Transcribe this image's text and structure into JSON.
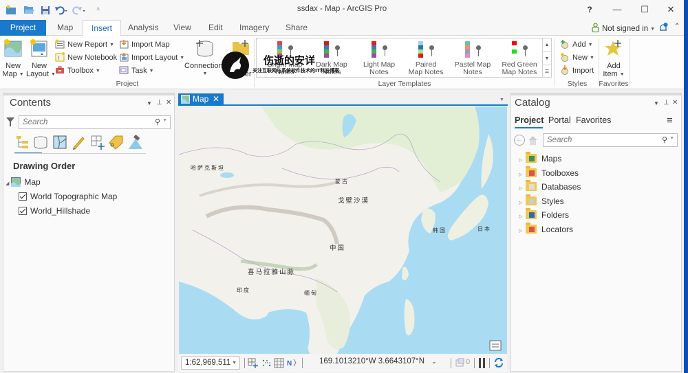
{
  "window": {
    "title": "ssdax - Map - ArcGIS Pro",
    "help": "?",
    "minimize": "—",
    "maximize": "☐",
    "close": "✕"
  },
  "quick_access": [
    "new-project-icon",
    "open-project-icon",
    "save-project-icon",
    "undo-icon",
    "redo-icon",
    "customize-qat-icon"
  ],
  "account": {
    "label": "Not signed in",
    "icons": [
      "user-icon",
      "notification-bell-icon",
      "collapse-ribbon-icon"
    ]
  },
  "ribbon_tabs": [
    {
      "label": "Project"
    },
    {
      "label": "Map"
    },
    {
      "label": "Insert",
      "active": true
    },
    {
      "label": "Analysis"
    },
    {
      "label": "View"
    },
    {
      "label": "Edit"
    },
    {
      "label": "Imagery"
    },
    {
      "label": "Share"
    }
  ],
  "ribbon": {
    "project_group": {
      "label": "Project",
      "new_map": [
        "New",
        "Map"
      ],
      "new_layout": [
        "New",
        "Layout"
      ],
      "new_report": "New Report",
      "new_notebook": "New Notebook",
      "toolbox": "Toolbox",
      "import_map": "Import Map",
      "import_layout": "Import Layout",
      "task": "Task",
      "connections": "Connections",
      "add_folder": "Add Folder"
    },
    "layer_templates": {
      "label": "Layer Templates",
      "items": [
        {
          "line1": "Bright Map",
          "line2": "Notes",
          "colors": [
            "#e8434c",
            "#2aa3dc",
            "#9bc53d",
            "#a64ca6"
          ]
        },
        {
          "line1": "Dark Map",
          "line2": "Notes",
          "colors": [
            "#d7191c",
            "#2b83ba",
            "#4daf4a",
            "#984ea3"
          ]
        },
        {
          "line1": "Light Map",
          "line2": "Notes",
          "colors": [
            "#e41a1c",
            "#377eb8",
            "#4daf4a",
            "#984ea3"
          ]
        },
        {
          "line1": "Paired",
          "line2": "Map Notes",
          "colors": [
            "#a6cee3",
            "#1f78b4",
            "#b2df8a",
            "#e31a1c"
          ]
        },
        {
          "line1": "Pastel Map",
          "line2": "Notes",
          "colors": [
            "#66c2a5",
            "#fc8d62",
            "#8da0cb",
            "#e78ac3"
          ]
        },
        {
          "line1": "Red Green",
          "line2": "Map Notes",
          "colors": [
            "#ff0000",
            "#ffffff",
            "#22dd22",
            "#ffffff"
          ]
        }
      ]
    },
    "styles_group": {
      "label": "Styles",
      "add": "Add",
      "new": "New",
      "import": "Import"
    },
    "favorites_group": {
      "label": "Favorites",
      "add_item": [
        "Add",
        "Item"
      ]
    }
  },
  "watermark": {
    "title": "伤逝的安详",
    "subtitle": "关注互联网与系统软件技术的IT科技博客"
  },
  "contents": {
    "title": "Contents",
    "search_placeholder": "Search",
    "toolbar_icons": [
      "list-by-drawing-order-icon",
      "list-by-data-source-icon",
      "list-by-selection-icon",
      "list-by-editing-icon",
      "list-by-snapping-icon",
      "list-by-labeling-icon",
      "list-by-perspective-imagery-icon"
    ],
    "section_heading": "Drawing Order",
    "map_node": "Map",
    "layers": [
      {
        "name": "World Topographic Map",
        "checked": true
      },
      {
        "name": "World_Hillshade",
        "checked": true
      }
    ]
  },
  "map_view": {
    "tab_label": "Map",
    "labels": [
      {
        "text": "哈萨克斯坦"
      },
      {
        "text": "蒙古"
      },
      {
        "text": "戈壁沙漠"
      },
      {
        "text": "中国"
      },
      {
        "text": "韩国"
      },
      {
        "text": "日本"
      },
      {
        "text": "喜马拉雅山脉"
      },
      {
        "text": "印度"
      },
      {
        "text": "缅甸"
      }
    ],
    "status": {
      "scale": "1:62,969,511",
      "coordinates": "169.1013210°W 3.6643107°N",
      "selected_count": "0"
    }
  },
  "catalog": {
    "title": "Catalog",
    "tabs": [
      {
        "label": "Project",
        "active": true
      },
      {
        "label": "Portal"
      },
      {
        "label": "Favorites"
      }
    ],
    "search_placeholder": "Search",
    "items": [
      {
        "label": "Maps",
        "icon": "maps-folder-icon",
        "accent": "#3a8f5f"
      },
      {
        "label": "Toolboxes",
        "icon": "toolboxes-folder-icon",
        "accent": "#d9534f"
      },
      {
        "label": "Databases",
        "icon": "databases-folder-icon",
        "accent": "#dddddd"
      },
      {
        "label": "Styles",
        "icon": "styles-folder-icon",
        "accent": "#cccccc"
      },
      {
        "label": "Folders",
        "icon": "folders-folder-icon",
        "accent": "#2b6cb0"
      },
      {
        "label": "Locators",
        "icon": "locators-folder-icon",
        "accent": "#d9534f"
      }
    ]
  },
  "colors": {
    "accent": "#1979ca",
    "window_border": "#0a4fb5"
  }
}
